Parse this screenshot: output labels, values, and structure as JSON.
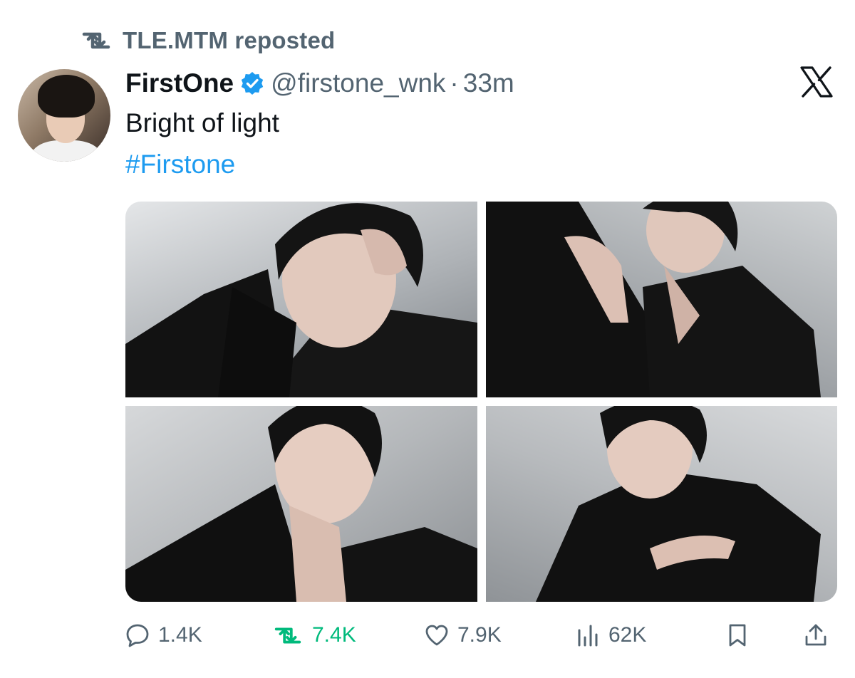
{
  "repost_banner": {
    "text": "TLE.MTM reposted",
    "icon": "repost-icon"
  },
  "tweet": {
    "display_name": "FirstOne",
    "verified": true,
    "handle": "@firstone_wnk",
    "separator": "·",
    "time": "33m",
    "text": "Bright of light",
    "hashtag": "#Firstone",
    "media_count": 4
  },
  "actions": {
    "replies": "1.4K",
    "reposts": "7.4K",
    "likes": "7.9K",
    "views": "62K"
  },
  "colors": {
    "accent": "#1d9bf0",
    "secondary_text": "#536471",
    "repost_active": "#00ba7c",
    "primary_text": "#0f1419"
  }
}
